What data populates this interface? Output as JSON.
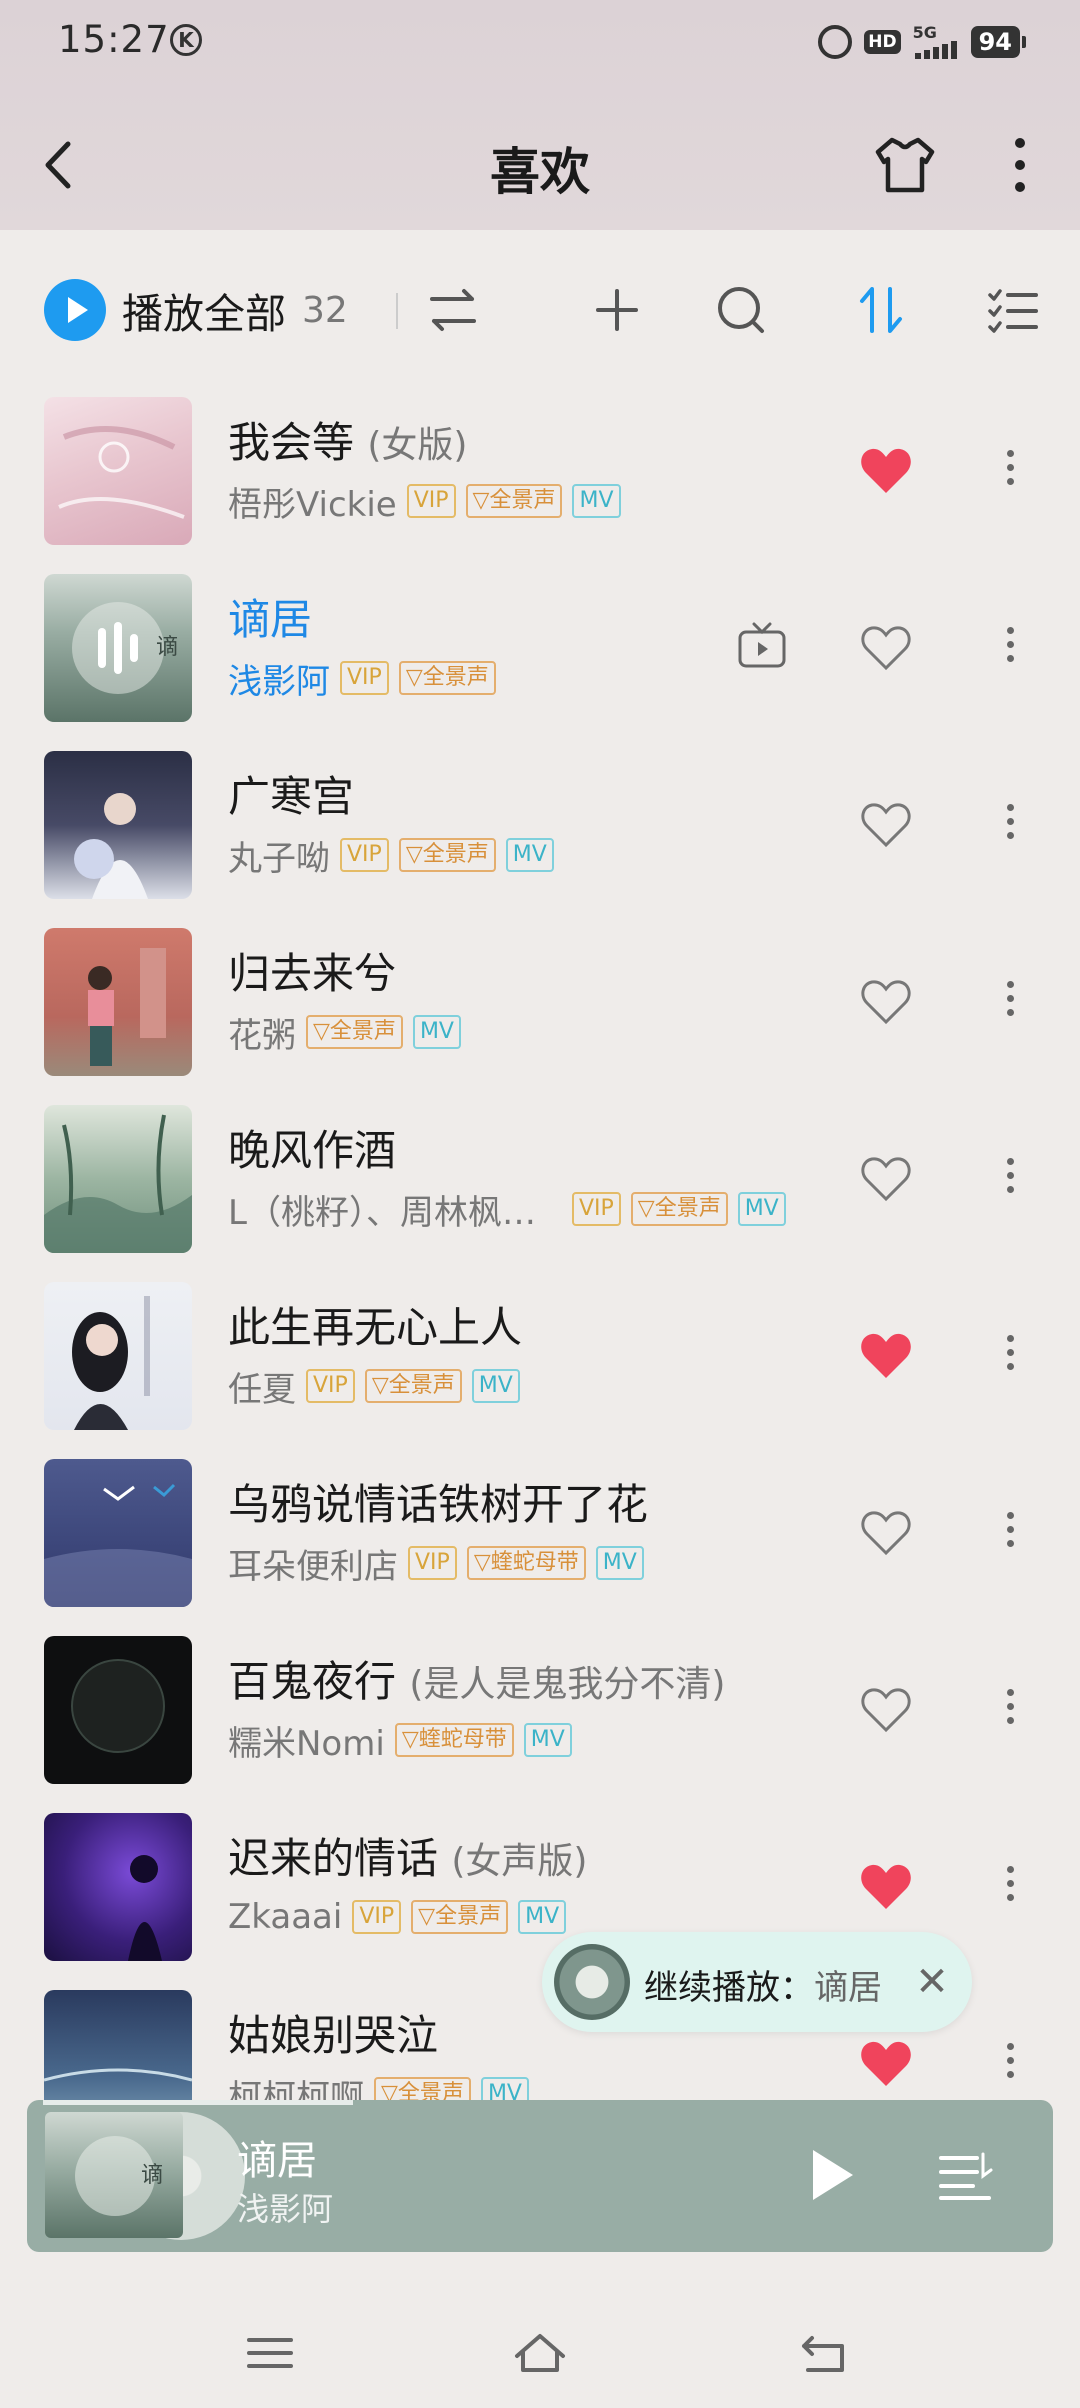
{
  "status_bar": {
    "time": "15:27",
    "k_badge": "K",
    "hd": "HD",
    "network": "5G",
    "battery": "94"
  },
  "header": {
    "title": "喜欢"
  },
  "toolbar": {
    "play_all": "播放全部",
    "count": "32"
  },
  "songs": [
    {
      "title": "我会等",
      "subtitle": "(女版)",
      "artist": "梧彤Vickie",
      "tags": [
        "VIP",
        "全景声",
        "MV"
      ],
      "liked": true,
      "active": false
    },
    {
      "title": "谪居",
      "subtitle": "",
      "artist": "浅影阿",
      "tags": [
        "VIP",
        "全景声"
      ],
      "liked": false,
      "active": true
    },
    {
      "title": "广寒宫",
      "subtitle": "",
      "artist": "丸子呦",
      "tags": [
        "VIP",
        "全景声",
        "MV"
      ],
      "liked": false,
      "active": false
    },
    {
      "title": "归去来兮",
      "subtitle": "",
      "artist": "花粥",
      "tags": [
        "全景声",
        "MV"
      ],
      "liked": false,
      "active": false
    },
    {
      "title": "晚风作酒",
      "subtitle": "",
      "artist": "L（桃籽）、周林枫…",
      "tags": [
        "VIP",
        "全景声",
        "MV"
      ],
      "liked": false,
      "active": false
    },
    {
      "title": "此生再无心上人",
      "subtitle": "",
      "artist": "任夏",
      "tags": [
        "VIP",
        "全景声",
        "MV"
      ],
      "liked": true,
      "active": false
    },
    {
      "title": "乌鸦说情话铁树开了花",
      "subtitle": "",
      "artist": "耳朵便利店",
      "tags": [
        "VIP",
        "蝰蛇母带",
        "MV"
      ],
      "liked": false,
      "active": false
    },
    {
      "title": "百鬼夜行",
      "subtitle": "(是人是鬼我分不清)",
      "artist": "糯米Nomi",
      "tags": [
        "蝰蛇母带",
        "MV"
      ],
      "liked": false,
      "active": false
    },
    {
      "title": "迟来的情话",
      "subtitle": "(女声版)",
      "artist": "Zkaaai",
      "tags": [
        "VIP",
        "全景声",
        "MV"
      ],
      "liked": true,
      "active": false
    },
    {
      "title": "姑娘别哭泣",
      "subtitle": "",
      "artist": "柯柯柯啊",
      "tags": [
        "全景声",
        "MV"
      ],
      "liked": true,
      "active": false
    }
  ],
  "toast": {
    "label": "继续播放：",
    "song": "谪居",
    "close": "✕"
  },
  "player": {
    "title": "谪居",
    "artist": "浅影阿"
  },
  "colors": {
    "accent": "#1e9bf0",
    "like": "#f0445c",
    "vip": "#d8a43a",
    "mv": "#3bb3c8",
    "player_bg": "#98ada5"
  }
}
